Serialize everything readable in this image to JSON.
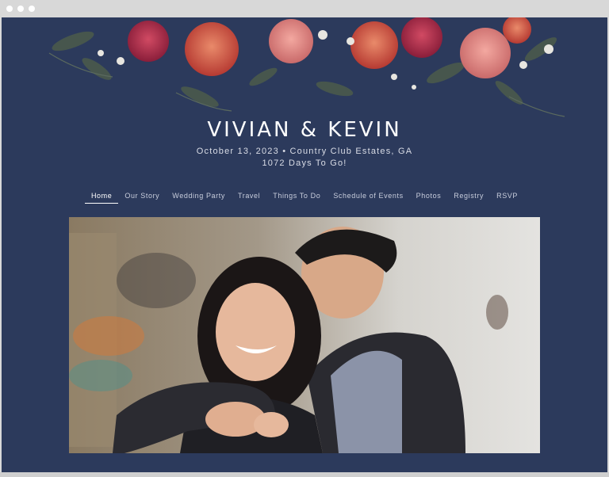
{
  "site": {
    "couple": "VIVIAN & KEVIN",
    "event_line": "October 13, 2023 • Country Club Estates, GA",
    "countdown": "1072 Days To Go!"
  },
  "nav": {
    "items": [
      {
        "label": "Home",
        "active": true
      },
      {
        "label": "Our Story"
      },
      {
        "label": "Wedding Party"
      },
      {
        "label": "Travel"
      },
      {
        "label": "Things To Do"
      },
      {
        "label": "Schedule of Events"
      },
      {
        "label": "Photos"
      },
      {
        "label": "Registry"
      },
      {
        "label": "RSVP"
      }
    ]
  },
  "hero": {
    "photo": "engagement-photo"
  },
  "colors": {
    "background": "#2c3a5c",
    "accent_floral_red": "#b83240",
    "accent_floral_coral": "#e06b4d"
  }
}
